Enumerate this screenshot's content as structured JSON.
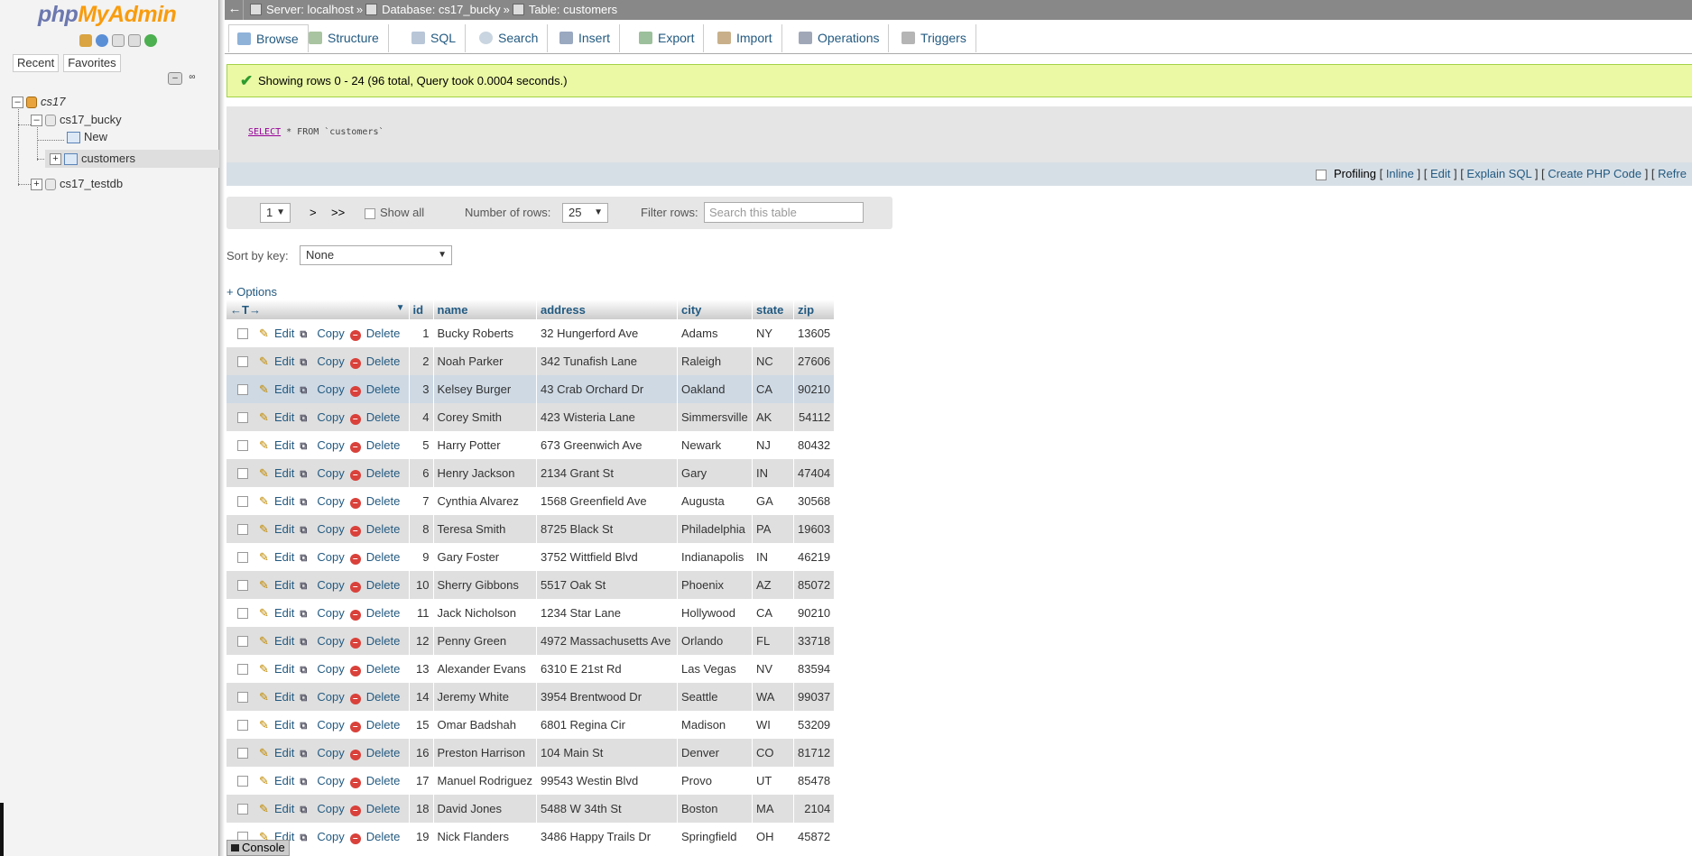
{
  "nav": {
    "logo_php": "php",
    "logo_my": "MyAdmin",
    "tabs": [
      "Recent",
      "Favorites"
    ],
    "tree": {
      "server": "cs17",
      "db1": "cs17_bucky",
      "new": "New",
      "table": "customers",
      "db2": "cs17_testdb"
    }
  },
  "breadcrumb": {
    "server": "Server: localhost",
    "database": "Database: cs17_bucky",
    "table": "Table: customers",
    "sep": "»"
  },
  "tabs": [
    "Browse",
    "Structure",
    "SQL",
    "Search",
    "Insert",
    "Export",
    "Import",
    "Operations",
    "Triggers"
  ],
  "message": "Showing rows 0 - 24 (96 total, Query took 0.0004 seconds.)",
  "sql": {
    "keyword": "SELECT",
    "rest": " * FROM `customers`"
  },
  "profiling": {
    "label": "Profiling",
    "links": [
      "Inline",
      "Edit",
      "Explain SQL",
      "Create PHP Code",
      "Refre"
    ]
  },
  "navform": {
    "page": "1",
    "next": ">",
    "last": ">>",
    "show_all": "Show all",
    "num_rows_label": "Number of rows:",
    "num_rows": "25",
    "filter_label": "Filter rows:",
    "filter_placeholder": "Search this table"
  },
  "sort": {
    "label": "Sort by key:",
    "value": "None"
  },
  "options": "+ Options",
  "table": {
    "arrows": "←T→",
    "columns": [
      "id",
      "name",
      "address",
      "city",
      "state",
      "zip"
    ],
    "actions": {
      "edit": "Edit",
      "copy": "Copy",
      "delete": "Delete"
    },
    "rows": [
      {
        "id": "1",
        "name": "Bucky Roberts",
        "address": "32 Hungerford Ave",
        "city": "Adams",
        "state": "NY",
        "zip": "13605"
      },
      {
        "id": "2",
        "name": "Noah Parker",
        "address": "342 Tunafish Lane",
        "city": "Raleigh",
        "state": "NC",
        "zip": "27606"
      },
      {
        "id": "3",
        "name": "Kelsey Burger",
        "address": "43 Crab Orchard Dr",
        "city": "Oakland",
        "state": "CA",
        "zip": "90210"
      },
      {
        "id": "4",
        "name": "Corey Smith",
        "address": "423 Wisteria Lane",
        "city": "Simmersville",
        "state": "AK",
        "zip": "54112"
      },
      {
        "id": "5",
        "name": "Harry Potter",
        "address": "673 Greenwich Ave",
        "city": "Newark",
        "state": "NJ",
        "zip": "80432"
      },
      {
        "id": "6",
        "name": "Henry Jackson",
        "address": "2134 Grant St",
        "city": "Gary",
        "state": "IN",
        "zip": "47404"
      },
      {
        "id": "7",
        "name": "Cynthia Alvarez",
        "address": "1568 Greenfield Ave",
        "city": "Augusta",
        "state": "GA",
        "zip": "30568"
      },
      {
        "id": "8",
        "name": "Teresa Smith",
        "address": "8725 Black St",
        "city": "Philadelphia",
        "state": "PA",
        "zip": "19603"
      },
      {
        "id": "9",
        "name": "Gary Foster",
        "address": "3752 Wittfield Blvd",
        "city": "Indianapolis",
        "state": "IN",
        "zip": "46219"
      },
      {
        "id": "10",
        "name": "Sherry Gibbons",
        "address": "5517 Oak St",
        "city": "Phoenix",
        "state": "AZ",
        "zip": "85072"
      },
      {
        "id": "11",
        "name": "Jack Nicholson",
        "address": "1234 Star Lane",
        "city": "Hollywood",
        "state": "CA",
        "zip": "90210"
      },
      {
        "id": "12",
        "name": "Penny Green",
        "address": "4972 Massachusetts Ave",
        "city": "Orlando",
        "state": "FL",
        "zip": "33718"
      },
      {
        "id": "13",
        "name": "Alexander Evans",
        "address": "6310 E 21st Rd",
        "city": "Las Vegas",
        "state": "NV",
        "zip": "83594"
      },
      {
        "id": "14",
        "name": "Jeremy White",
        "address": "3954 Brentwood Dr",
        "city": "Seattle",
        "state": "WA",
        "zip": "99037"
      },
      {
        "id": "15",
        "name": "Omar Badshah",
        "address": "6801 Regina Cir",
        "city": "Madison",
        "state": "WI",
        "zip": "53209"
      },
      {
        "id": "16",
        "name": "Preston Harrison",
        "address": "104 Main St",
        "city": "Denver",
        "state": "CO",
        "zip": "81712"
      },
      {
        "id": "17",
        "name": "Manuel Rodriguez",
        "address": "99543 Westin Blvd",
        "city": "Provo",
        "state": "UT",
        "zip": "85478"
      },
      {
        "id": "18",
        "name": "David Jones",
        "address": "5488 W 34th St",
        "city": "Boston",
        "state": "MA",
        "zip": "2104"
      },
      {
        "id": "19",
        "name": "Nick Flanders",
        "address": "3486 Happy Trails Dr",
        "city": "Springfield",
        "state": "OH",
        "zip": "45872"
      }
    ]
  },
  "console": "Console",
  "colors": {
    "link": "#235a81",
    "success_bg": "#ebf8a4",
    "highlight_row": "#ced9e4",
    "even_row": "#dfdfdf"
  }
}
